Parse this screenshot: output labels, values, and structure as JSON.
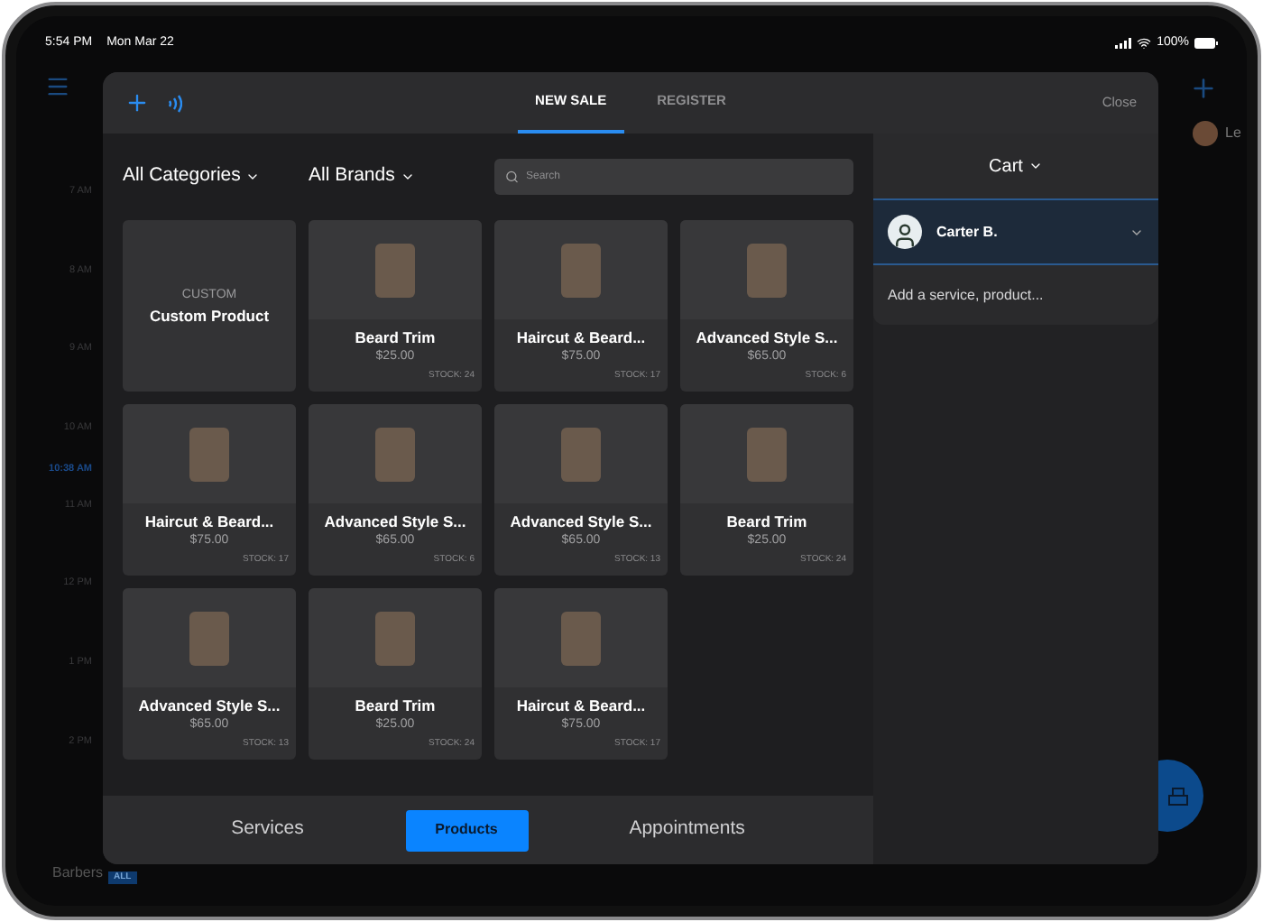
{
  "status_bar": {
    "time": "5:54 PM",
    "date": "Mon Mar 22",
    "battery": "100%"
  },
  "background": {
    "user_name": "Le",
    "filter_label": "Barbers",
    "filter_badge": "ALL",
    "time_labels": [
      {
        "kind": "hour",
        "label": "7 AM"
      },
      {
        "kind": "hour",
        "label": "8 AM"
      },
      {
        "kind": "hour",
        "label": "9 AM"
      },
      {
        "kind": "hour",
        "label": "10 AM"
      },
      {
        "kind": "now",
        "label": "10:38 AM"
      },
      {
        "kind": "hour",
        "label": "11 AM"
      },
      {
        "kind": "hour",
        "label": "12 PM"
      },
      {
        "kind": "hour",
        "label": "1 PM"
      },
      {
        "kind": "hour",
        "label": "2 PM"
      }
    ]
  },
  "modal": {
    "tabs": [
      {
        "label": "NEW SALE",
        "selected": true
      },
      {
        "label": "REGISTER",
        "selected": false
      }
    ],
    "close": "Close",
    "category_filter": "All Categories",
    "brand_filter": "All Brands",
    "search": {
      "placeholder": "Search"
    },
    "products": [
      {
        "kind": "custom",
        "caption": "CUSTOM",
        "name": "Custom Product"
      },
      {
        "kind": "product",
        "name": "Beard Trim",
        "price": "$25.00",
        "stock": "STOCK: 24"
      },
      {
        "kind": "product",
        "name": "Haircut & Beard...",
        "price": "$75.00",
        "stock": "STOCK: 17"
      },
      {
        "kind": "product",
        "name": "Advanced Style S...",
        "price": "$65.00",
        "stock": "STOCK: 6"
      },
      {
        "kind": "product",
        "name": "Haircut & Beard...",
        "price": "$75.00",
        "stock": "STOCK: 17"
      },
      {
        "kind": "product",
        "name": "Advanced Style S...",
        "price": "$65.00",
        "stock": "STOCK: 6"
      },
      {
        "kind": "product",
        "name": "Advanced Style S...",
        "price": "$65.00",
        "stock": "STOCK: 13"
      },
      {
        "kind": "product",
        "name": "Beard Trim",
        "price": "$25.00",
        "stock": "STOCK: 24"
      },
      {
        "kind": "product",
        "name": "Advanced Style S...",
        "price": "$65.00",
        "stock": "STOCK: 13"
      },
      {
        "kind": "product",
        "name": "Beard Trim",
        "price": "$25.00",
        "stock": "STOCK: 24"
      },
      {
        "kind": "product",
        "name": "Haircut & Beard...",
        "price": "$75.00",
        "stock": "STOCK: 17"
      }
    ],
    "bottom_tabs": [
      {
        "label": "Services",
        "selected": false
      },
      {
        "label": "Products",
        "selected": true
      },
      {
        "label": "Appointments",
        "selected": false
      }
    ]
  },
  "cart": {
    "title": "Cart",
    "customer": "Carter B.",
    "add_prompt": "Add a service, product..."
  }
}
